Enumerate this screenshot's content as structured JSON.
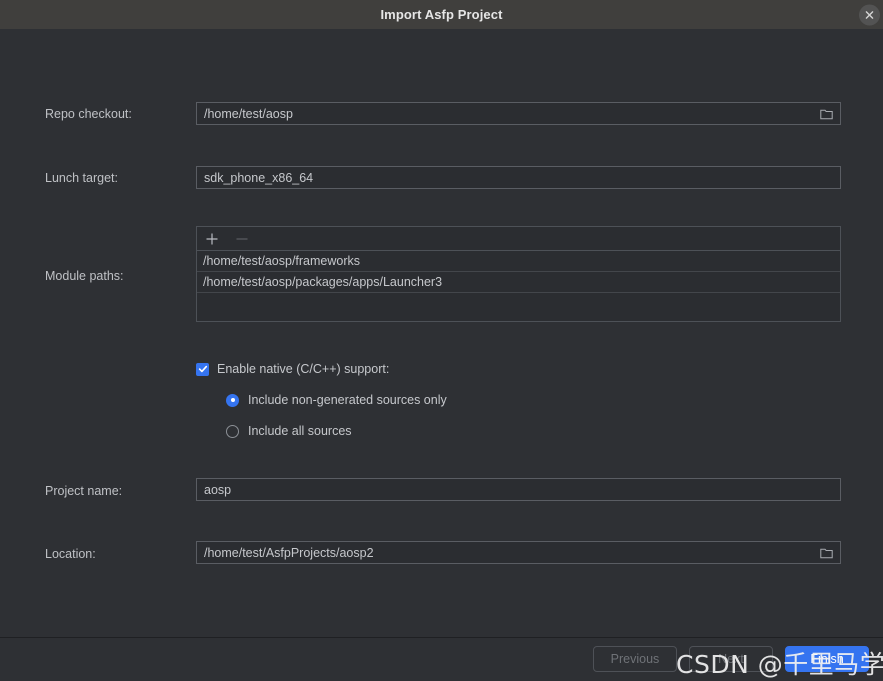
{
  "window": {
    "title": "Import Asfp Project",
    "close_icon": "close-icon"
  },
  "form": {
    "repo_checkout": {
      "label": "Repo checkout:",
      "value": "/home/test/aosp",
      "browse_icon": "folder-icon"
    },
    "lunch_target": {
      "label": "Lunch target:",
      "value": "sdk_phone_x86_64"
    },
    "module_paths": {
      "label": "Module paths:",
      "add_icon": "plus-icon",
      "remove_icon": "minus-icon",
      "items": [
        "/home/test/aosp/frameworks",
        "/home/test/aosp/packages/apps/Launcher3"
      ]
    },
    "native_support": {
      "label": "Enable native (C/C++) support:",
      "checked": true,
      "options": [
        {
          "label": "Include non-generated sources only",
          "selected": true
        },
        {
          "label": "Include all sources",
          "selected": false
        }
      ]
    },
    "project_name": {
      "label": "Project name:",
      "value": "aosp"
    },
    "location": {
      "label": "Location:",
      "value": "/home/test/AsfpProjects/aosp2",
      "browse_icon": "folder-icon"
    }
  },
  "footer": {
    "previous_label": "Previous",
    "next_label": "Next",
    "finish_label": "Finish"
  },
  "watermark": {
    "text": "CSDN @千里马学框架"
  },
  "colors": {
    "accent": "#3574f0",
    "titlebar": "#403f3d",
    "body": "#2e3034",
    "field_bg": "#2b2d31",
    "text": "#c6c8cc"
  }
}
